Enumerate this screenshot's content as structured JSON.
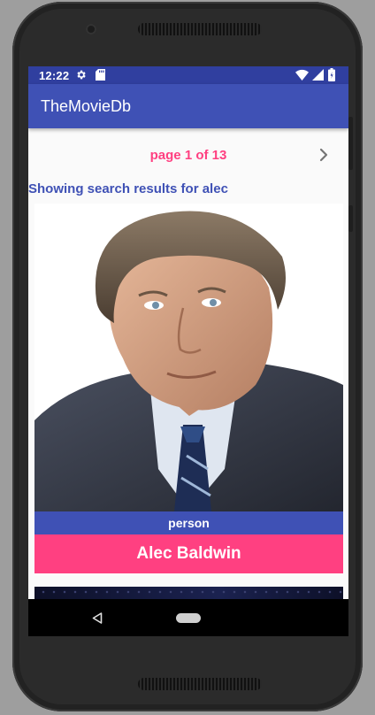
{
  "status_bar": {
    "time": "12:22",
    "icons": [
      "gear-icon",
      "sd-card-icon",
      "wifi-icon",
      "signal-icon",
      "battery-icon"
    ]
  },
  "app_bar": {
    "title": "TheMovieDb"
  },
  "pager": {
    "label": "page 1 of 13",
    "next_icon": "chevron-right-icon"
  },
  "search": {
    "results_label": "Showing search results for alec"
  },
  "results": [
    {
      "type": "person",
      "name": "Alec Baldwin"
    }
  ],
  "nav_bar": {
    "icons": [
      "back-icon",
      "home-icon"
    ]
  },
  "colors": {
    "primary": "#3f51b5",
    "primary_dark": "#303f9f",
    "accent": "#ff4081",
    "screen_bg": "#fafafa"
  }
}
